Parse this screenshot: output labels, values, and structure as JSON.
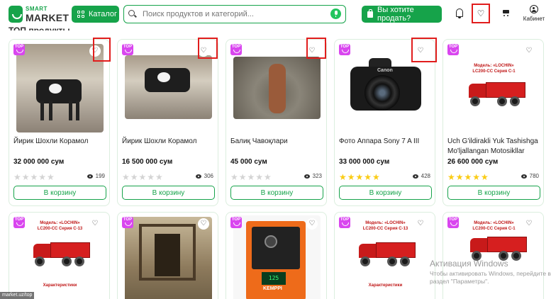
{
  "header": {
    "logo_small": "SMART",
    "logo_big": "MARKET",
    "catalog_label": "Каталог",
    "search_placeholder": "Поиск продуктов и категорий...",
    "sell_label": "Вы хотите продать?",
    "cabinet_label": "Кабинет"
  },
  "badge": "TOP",
  "cart_button_label": "В корзину",
  "products": [
    {
      "title": "Йирик Шохли Корамол",
      "price": "32 000 000 сум",
      "views": "199",
      "rating": 0
    },
    {
      "title": "Йирик Шохли Корамол",
      "price": "16 500 000 сум",
      "views": "306",
      "rating": 0
    },
    {
      "title": "Балиқ Чавоқлари",
      "price": "45 000 сум",
      "views": "323",
      "rating": 0
    },
    {
      "title": "Фото Аппара Sony 7 A III",
      "price": "33 000 000 сум",
      "views": "428",
      "rating": 5
    },
    {
      "title": "Uch G'ildirakli Yuk Tashishga Mo'ljallangan Motosikllar",
      "price": "26 600 000 сум",
      "views": "780",
      "rating": 5
    }
  ],
  "images": {
    "camera_brand": "Canon",
    "truck_doc_title": "Модель: «LOCHIN»",
    "truck_doc_series_1": "LC200-CC Серия С-1",
    "truck_doc_series_13": "LC200-CC Серия С-13",
    "truck_doc_spec": "Характеристики",
    "welder_display": "125",
    "welder_brand": "KEMPPI"
  },
  "watermark": {
    "title": "Активация Windows",
    "subtitle": "Чтобы активировать Windows, перейдите в раздел \"Параметры\"."
  },
  "status_url": "market.uz/top"
}
